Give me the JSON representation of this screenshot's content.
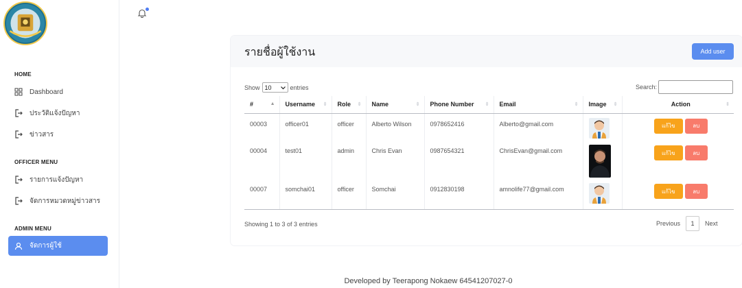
{
  "sidebar": {
    "sections": [
      {
        "title": "HOME",
        "items": [
          {
            "label": "Dashboard",
            "icon": "grid-icon"
          },
          {
            "label": "ประวัติแจ้งปัญหา",
            "icon": "logout-icon"
          },
          {
            "label": "ข่าวสาร",
            "icon": "logout-icon"
          }
        ]
      },
      {
        "title": "OFFICER MENU",
        "items": [
          {
            "label": "รายการแจ้งปัญหา",
            "icon": "logout-icon"
          },
          {
            "label": "จัดการหมวดหมู่ข่าวสาร",
            "icon": "logout-icon"
          }
        ]
      },
      {
        "title": "ADMIN MENU",
        "items": [
          {
            "label": "จัดการผู้ใช้",
            "icon": "user-icon",
            "active": true
          }
        ]
      }
    ],
    "accent": "#5b8def"
  },
  "card": {
    "title": "รายชื่อผู้ใช้งาน",
    "add_label": "Add user",
    "show_label": "Show",
    "entries_value": "10",
    "entries_label": "entries",
    "search_label": "Search:"
  },
  "table": {
    "headers": [
      "#",
      "Username",
      "Role",
      "Name",
      "Phone Number",
      "Email",
      "Image",
      "Action"
    ],
    "rows": [
      {
        "id": "00003",
        "username": "officer01",
        "role": "officer",
        "name": "Alberto Wilson",
        "phone": "0978652416",
        "email": "Alberto@gmail.com"
      },
      {
        "id": "00004",
        "username": "test01",
        "role": "admin",
        "name": "Chris Evan",
        "phone": "0987654321",
        "email": "ChrisEvan@gmail.com"
      },
      {
        "id": "00007",
        "username": "somchai01",
        "role": "officer",
        "name": "Somchai",
        "phone": "0912830198",
        "email": "amnolife77@gmail.com"
      }
    ],
    "edit_label": "แก้ไข",
    "delete_label": "ลบ",
    "edit_color": "#f8a31b",
    "delete_color": "#f87b6b"
  },
  "pagination": {
    "showing": "Showing 1 to 3 of 3 entries",
    "previous": "Previous",
    "page": "1",
    "next": "Next"
  },
  "footer": "Developed by Teerapong Nokaew 64541207027-0"
}
